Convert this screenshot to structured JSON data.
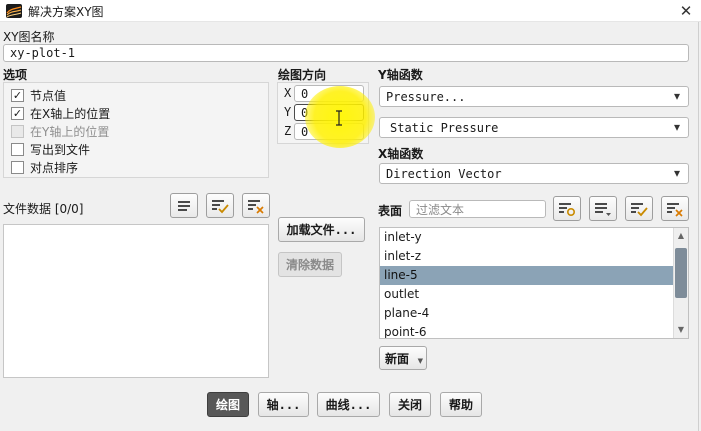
{
  "window": {
    "title": "解决方案XY图",
    "close_glyph": "✕"
  },
  "plot_name": {
    "label": "XY图名称",
    "value": "xy-plot-1"
  },
  "options": {
    "label": "选项",
    "items": [
      {
        "label": "节点值",
        "checked": true,
        "mark": "✓",
        "disabled": false
      },
      {
        "label": "在X轴上的位置",
        "checked": true,
        "mark": "✓",
        "disabled": false
      },
      {
        "label": "在Y轴上的位置",
        "checked": false,
        "mark": "",
        "disabled": true
      },
      {
        "label": "写出到文件",
        "checked": false,
        "mark": "",
        "disabled": false
      },
      {
        "label": "对点排序",
        "checked": false,
        "mark": "",
        "disabled": false
      }
    ]
  },
  "direction": {
    "label": "绘图方向",
    "x_label": "X",
    "x_value": "0",
    "y_label": "Y",
    "y_value": "0",
    "z_label": "Z",
    "z_value": "0"
  },
  "y_function": {
    "label": "Y轴函数",
    "category": "Pressure...",
    "quantity": "Static Pressure"
  },
  "x_function": {
    "label": "X轴函数",
    "value": "Direction Vector"
  },
  "file_data": {
    "label": "文件数据 [0/0]",
    "load_button": "加载文件...",
    "clear_button": "清除数据"
  },
  "surfaces": {
    "label": "表面",
    "filter_placeholder": "过滤文本",
    "items": [
      "inlet-y",
      "inlet-z",
      "line-5",
      "outlet",
      "plane-4",
      "point-6"
    ],
    "selected": "line-5",
    "new_button": "新面"
  },
  "bottom_buttons": {
    "plot": "绘图",
    "axes": "轴...",
    "curves": "曲线...",
    "close": "关闭",
    "help": "帮助"
  },
  "colors": {
    "selection": "#8ba3b6",
    "highlight": "#fff000",
    "check_accent": "#2e8b2e",
    "x_accent": "#d97a00"
  }
}
